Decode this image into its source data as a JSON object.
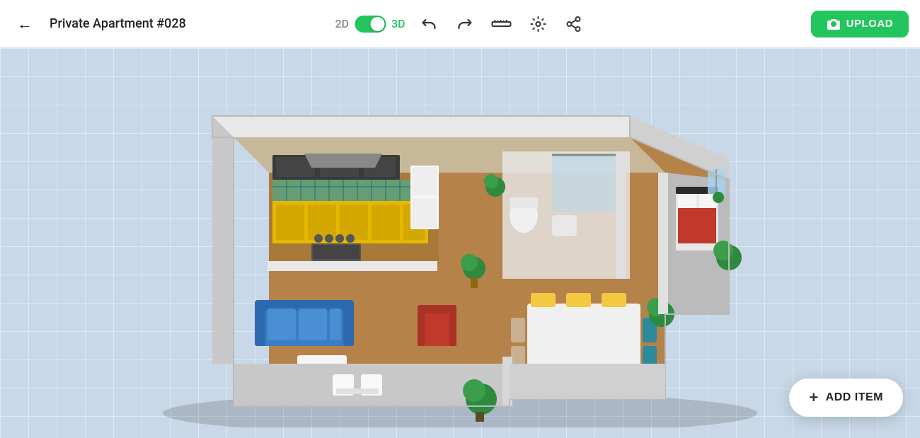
{
  "header": {
    "back_label": "←",
    "title": "Private Apartment #028",
    "view_2d_label": "2D",
    "view_3d_label": "3D",
    "toggle_state": "3D",
    "undo_icon": "undo",
    "redo_icon": "redo",
    "measure_icon": "measure",
    "settings_icon": "settings",
    "share_icon": "share",
    "upload_label": "UPLOAD",
    "camera_icon": "camera"
  },
  "canvas": {
    "background_color": "#c8d8e8"
  },
  "add_item_button": {
    "label": "ADD ITEM",
    "plus": "+"
  }
}
